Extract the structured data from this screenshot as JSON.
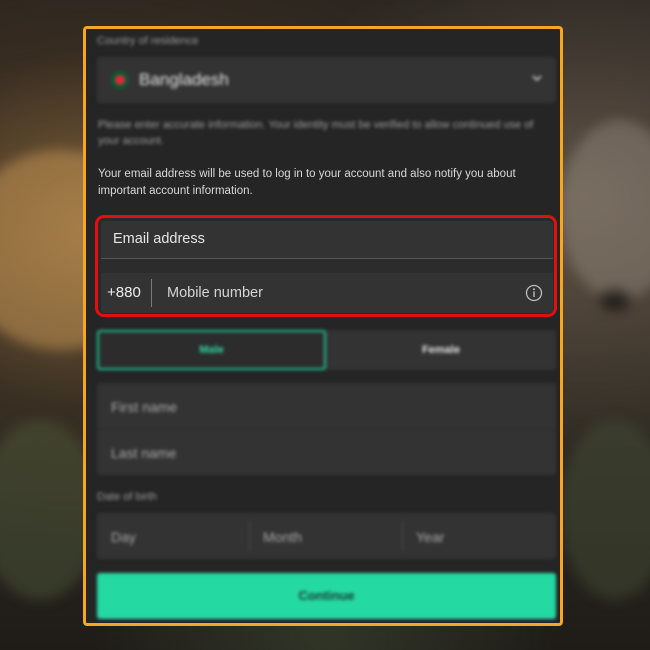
{
  "country": {
    "label": "Country of residence",
    "value": "Bangladesh"
  },
  "notice_identity": "Please enter accurate information. Your identity must be verified to allow continued use of your account.",
  "notice_email": "Your email address will be used to log in to your account and also notify you about important account information.",
  "email": {
    "placeholder": "Email address"
  },
  "mobile": {
    "country_code": "+880",
    "placeholder": "Mobile number"
  },
  "gender": {
    "male": "Male",
    "female": "Female",
    "selected": "Male"
  },
  "name": {
    "first_placeholder": "First name",
    "last_placeholder": "Last name"
  },
  "dob": {
    "label": "Date of birth",
    "day": "Day",
    "month": "Month",
    "year": "Year"
  },
  "continue_label": "Continue",
  "colors": {
    "frame": "#f5a623",
    "highlight": "#e01010",
    "accent": "#25d9a2"
  }
}
